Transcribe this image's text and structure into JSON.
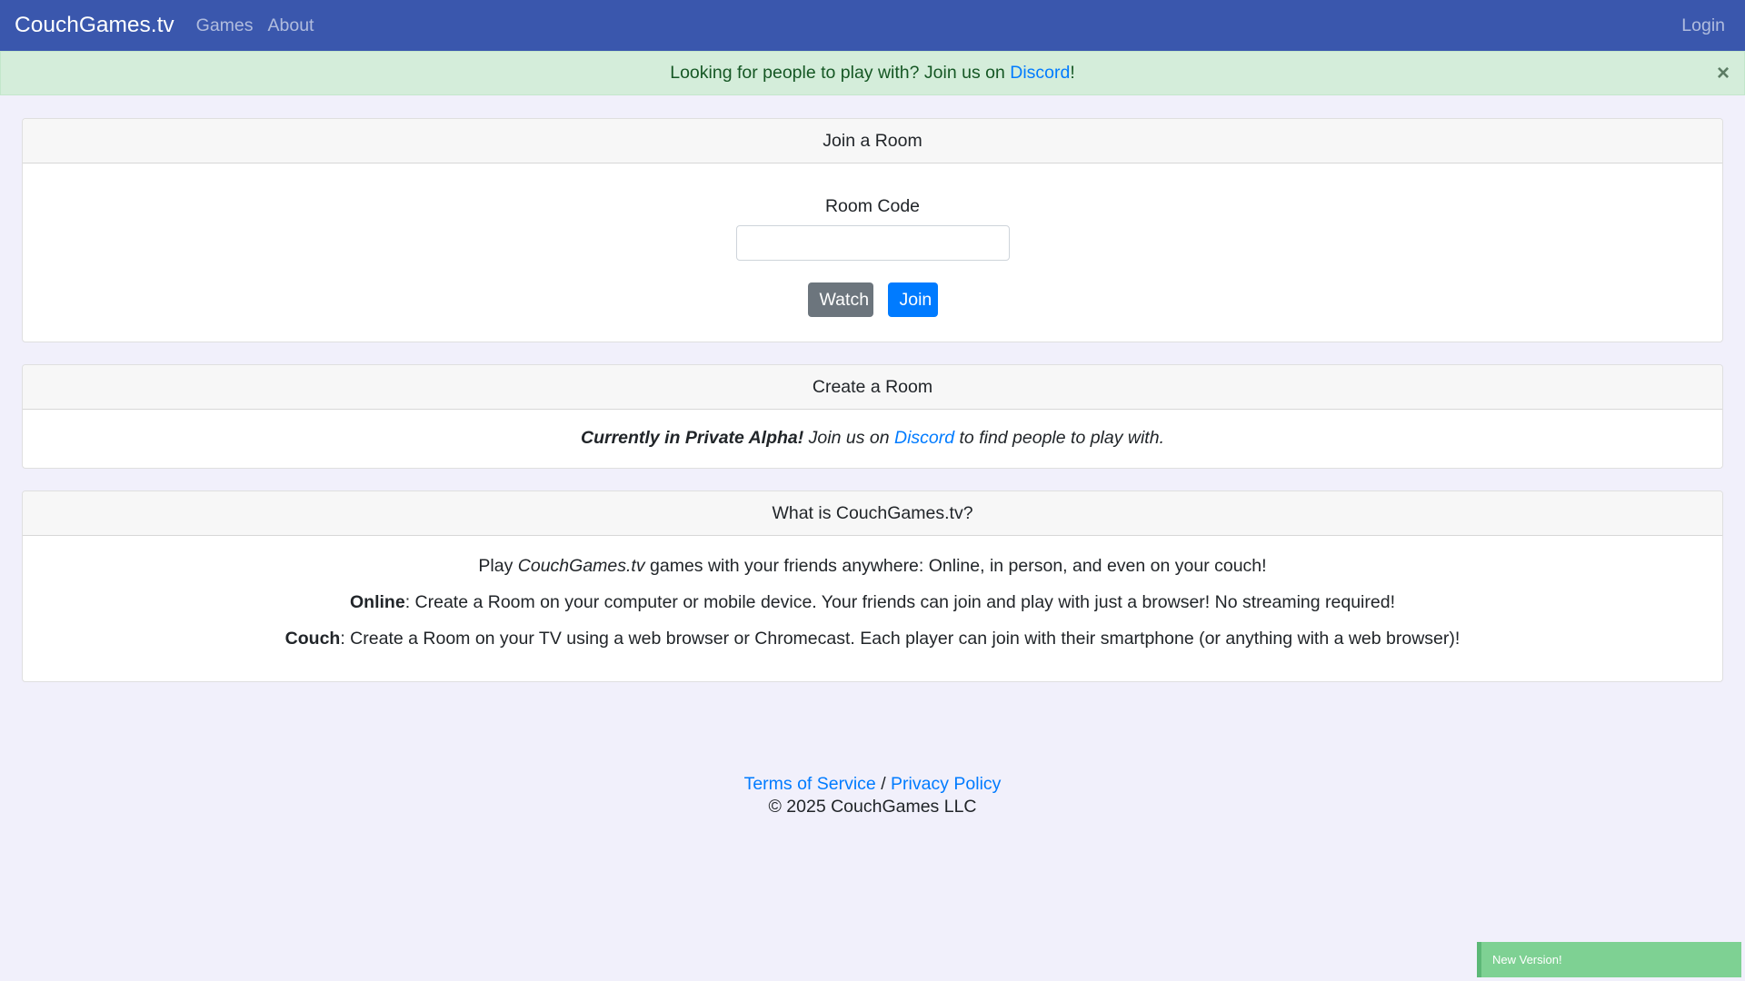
{
  "navbar": {
    "brand": "CouchGames.tv",
    "links": [
      "Games",
      "About"
    ],
    "login": "Login"
  },
  "alert": {
    "text_before": "Looking for people to play with? Join us on ",
    "link": "Discord",
    "text_after": "!",
    "close": "×"
  },
  "join_card": {
    "header": "Join a Room",
    "label": "Room Code",
    "input_value": "",
    "watch_button": "Watch",
    "join_button": "Join"
  },
  "create_card": {
    "header": "Create a Room",
    "bold_text": "Currently in Private Alpha!",
    "text_mid": " Join us on ",
    "link": "Discord",
    "text_after": " to find people to play with."
  },
  "what_card": {
    "header": "What is CouchGames.tv?",
    "p1_before": "Play ",
    "p1_em": "CouchGames.tv",
    "p1_after": " games with your friends anywhere: Online, in person, and even on your couch!",
    "p2_bold": "Online",
    "p2_text": ": Create a Room on your computer or mobile device. Your friends can join and play with just a browser! No streaming required!",
    "p3_bold": "Couch",
    "p3_text": ": Create a Room on your TV using a web browser or Chromecast. Each player can join with their smartphone (or anything with a web browser)!"
  },
  "footer": {
    "terms": "Terms of Service",
    "separator": " / ",
    "privacy": "Privacy Policy",
    "copyright": "© 2025 CouchGames LLC"
  },
  "toast": {
    "text": "New Version!"
  },
  "colors": {
    "navbar": "#3a57ad",
    "alert_bg": "#d4edda",
    "primary": "#007bff",
    "secondary": "#6c757d",
    "toast": "#7ed193",
    "page_bg": "#f1f0fb"
  }
}
